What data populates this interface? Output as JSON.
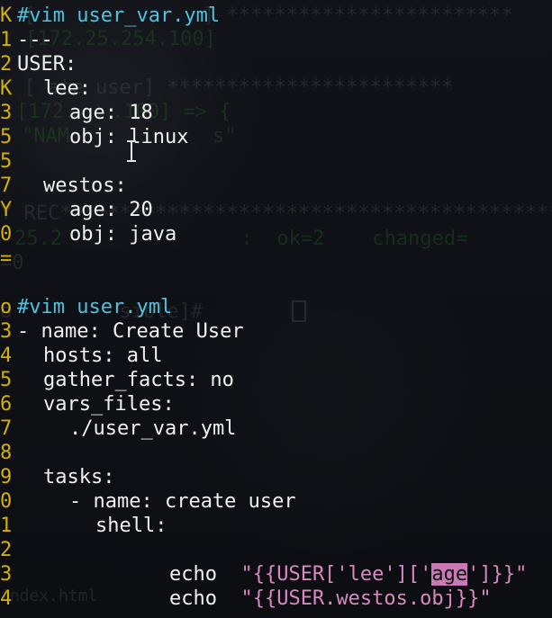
{
  "editor": {
    "line_1": "#vim user_var.yml",
    "line_2": "---",
    "line_3": "USER:",
    "line_4": "lee:",
    "line_5": "age: 18",
    "line_6": "obj: linux",
    "line_7": "",
    "line_8": "westos:",
    "line_9": "age: 20",
    "line_10": "obj: java",
    "line_11": "",
    "line_12": "",
    "line_13": "#vim user.yml",
    "line_14": "- name: Create User",
    "line_15": "hosts: all",
    "line_16": "gather_facts: no",
    "line_17": "vars_files:",
    "line_18": "./user_var.yml",
    "line_19": "",
    "line_20": "tasks:",
    "line_21": "- name: create user",
    "line_22": "shell:",
    "line_23_cmd": "echo",
    "line_23_str_prefix": "\"{{USER['lee']['",
    "line_23_highlight": "age",
    "line_23_str_suffix": "']}}\"",
    "line_24_cmd": "echo",
    "line_24_str": "\"{{USER.westos.obj}}\""
  },
  "gutter": {
    "row_1": "K",
    "row_2": "1",
    "row_3": "2",
    "row_4": "K",
    "row_5": "3",
    "row_6": "5",
    "row_7": "5",
    "row_8": "7",
    "row_9": "Y",
    "row_10": "0",
    "row_11": "=",
    "row_12": "",
    "row_13": "o",
    "row_14": "3",
    "row_15": "4",
    "row_16": "5",
    "row_17": "6",
    "row_18": "7",
    "row_19": "8",
    "row_20": "9",
    "row_21": "0",
    "row_22": "1",
    "row_23": "2",
    "row_24": "3",
    "row_25": "4"
  },
  "background": {
    "ghost_1": "K [              ] ************************",
    "ghost_2": "[172.25.254.100]",
    "ghost_3": "K [ ate user] ************************",
    "ghost_4": "[172.   .100] => {",
    "ghost_5": "\"NAM            s\"",
    "ghost_6": "Y REC**********************************************",
    "ghost_7": "25.2               :  ok=2    changed=",
    "ghost_8": "=0",
    "ghost_9": "o         sible]#",
    "ghost_10": "index.html"
  }
}
